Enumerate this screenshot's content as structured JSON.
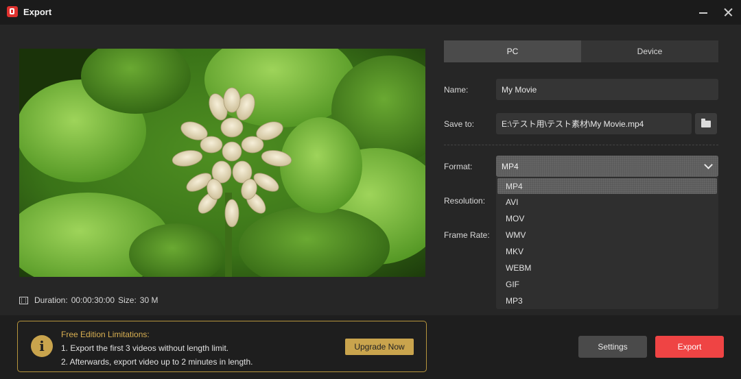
{
  "window": {
    "title": "Export"
  },
  "preview": {
    "duration_label": "Duration:",
    "duration": "00:00:30:00",
    "size_label": "Size:",
    "size": "30 M"
  },
  "tabs": [
    {
      "label": "PC",
      "active": true
    },
    {
      "label": "Device",
      "active": false
    }
  ],
  "form": {
    "name_label": "Name:",
    "name_value": "My Movie",
    "save_label": "Save to:",
    "save_value": "E:\\テスト用\\テスト素材\\My Movie.mp4",
    "format_label": "Format:",
    "format_value": "MP4",
    "resolution_label": "Resolution:",
    "frame_rate_label": "Frame Rate:"
  },
  "format_options": [
    "MP4",
    "AVI",
    "MOV",
    "WMV",
    "MKV",
    "WEBM",
    "GIF",
    "MP3"
  ],
  "notice": {
    "title": "Free Edition Limitations:",
    "line1": "1. Export the first 3 videos without length limit.",
    "line2": "2. Afterwards, export video up to 2 minutes in length.",
    "upgrade_label": "Upgrade Now",
    "icon": "info-icon"
  },
  "buttons": {
    "settings": "Settings",
    "export": "Export"
  },
  "colors": {
    "accent": "#ef4444",
    "notice": "#c9a44d"
  }
}
